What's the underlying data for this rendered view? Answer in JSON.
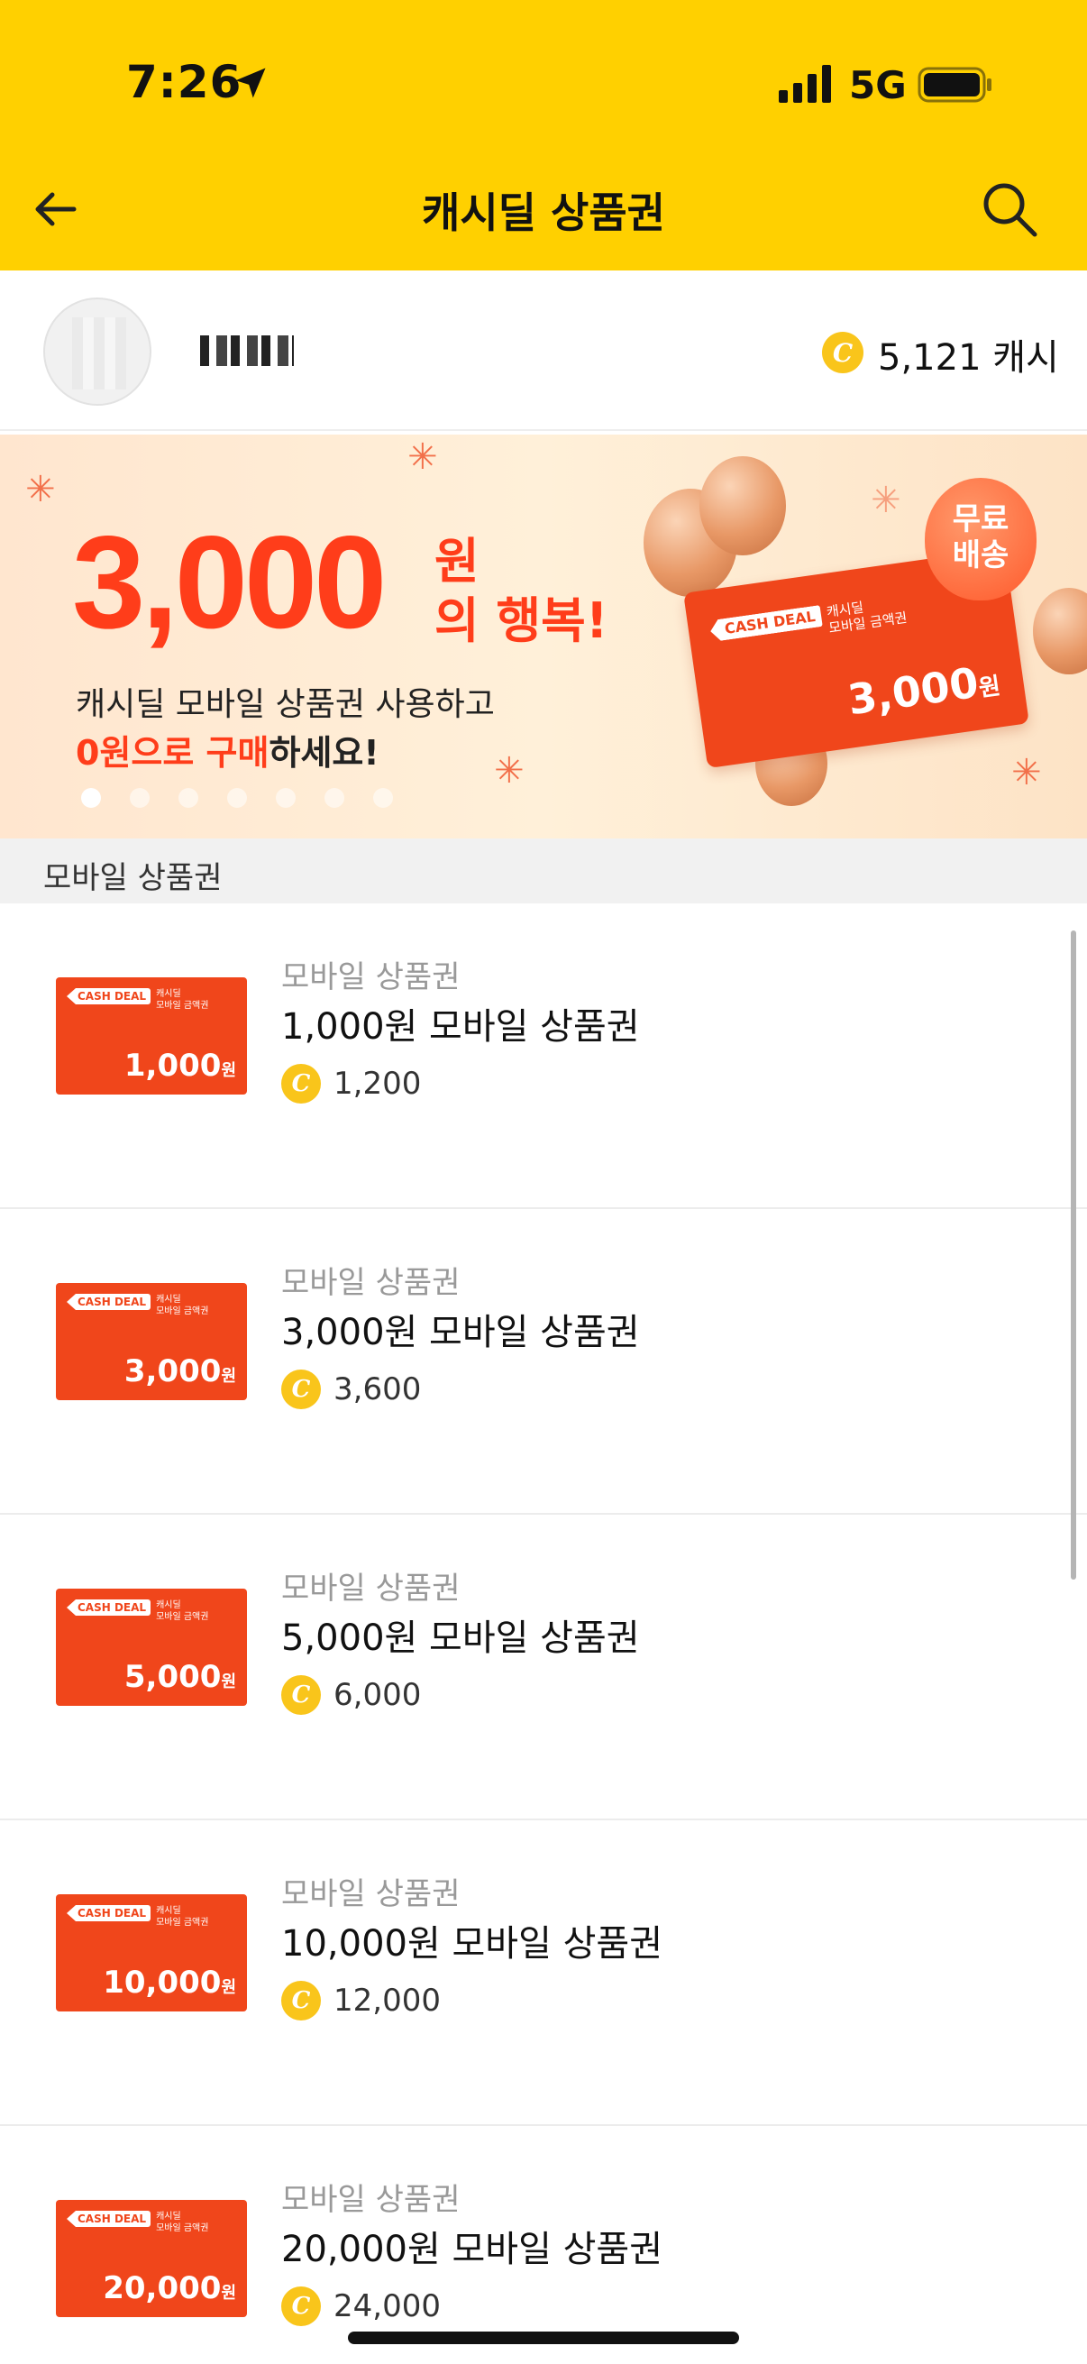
{
  "status_bar": {
    "time": "7:26",
    "network": "5G"
  },
  "nav": {
    "title": "캐시딜 상품권"
  },
  "profile": {
    "cash_amount": "5,121 캐시"
  },
  "banner": {
    "amount": "3,000",
    "won": "원",
    "happiness": "의 행복!",
    "line1": "캐시딜 모바일 상품권 사용하고",
    "line2_highlight": "0원으로 구매",
    "line2_rest": "하세요!",
    "badge": "무료\n배송",
    "card_logo": "CASH DEAL",
    "card_sub": "캐시딜\n모바일 금액권",
    "card_amount": "3,000",
    "card_won": "원",
    "dot_count": 7,
    "active_dot": 0
  },
  "section": {
    "title": "모바일 상품권"
  },
  "items": [
    {
      "category": "모바일 상품권",
      "title": "1,000원 모바일 상품권",
      "price": "1,200",
      "card_amount": "1,000",
      "card_won": "원",
      "card_logo": "CASH DEAL",
      "card_sub": "캐시딜\n모바일 금액권"
    },
    {
      "category": "모바일 상품권",
      "title": "3,000원 모바일 상품권",
      "price": "3,600",
      "card_amount": "3,000",
      "card_won": "원",
      "card_logo": "CASH DEAL",
      "card_sub": "캐시딜\n모바일 금액권"
    },
    {
      "category": "모바일 상품권",
      "title": "5,000원 모바일 상품권",
      "price": "6,000",
      "card_amount": "5,000",
      "card_won": "원",
      "card_logo": "CASH DEAL",
      "card_sub": "캐시딜\n모바일 금액권"
    },
    {
      "category": "모바일 상품권",
      "title": "10,000원 모바일 상품권",
      "price": "12,000",
      "card_amount": "10,000",
      "card_won": "원",
      "card_logo": "CASH DEAL",
      "card_sub": "캐시딜\n모바일 금액권"
    },
    {
      "category": "모바일 상품권",
      "title": "20,000원 모바일 상품권",
      "price": "24,000",
      "card_amount": "20,000",
      "card_won": "원",
      "card_logo": "CASH DEAL",
      "card_sub": "캐시딜\n모바일 금액권"
    }
  ],
  "colors": {
    "header": "#FFD000",
    "accent": "#F0461B",
    "coin": "#F9C51B"
  }
}
